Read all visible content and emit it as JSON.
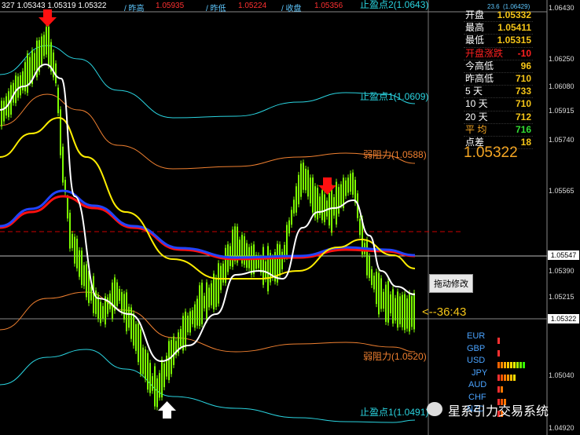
{
  "topbar": {
    "left": "327 1.05343 1.05319 1.05322",
    "open_label": "/ 昨高",
    "open_value": "1.05935",
    "low_label": "/ 昨低",
    "low_value": "1.05224",
    "close_label": "/ 收盘",
    "close_value": "1.05356",
    "spread_value": "23.6",
    "spread_peak": "(1.06429)"
  },
  "panel": {
    "rows": [
      {
        "k": "开盘",
        "v": "1.05332",
        "kc": "#ffffff",
        "vc": "#f5c518"
      },
      {
        "k": "最高",
        "v": "1.05411",
        "kc": "#ffffff",
        "vc": "#f5c518"
      },
      {
        "k": "最低",
        "v": "1.05315",
        "kc": "#ffffff",
        "vc": "#f5c518"
      },
      {
        "k": "开盘涨跌",
        "v": "-10",
        "kc": "#ff2020",
        "vc": "#ff2020"
      },
      {
        "k": "今高低",
        "v": "96",
        "kc": "#ffffff",
        "vc": "#f5c518"
      },
      {
        "k": "昨高低",
        "v": "710",
        "kc": "#ffffff",
        "vc": "#f5c518"
      },
      {
        "k": "5   天",
        "v": "733",
        "kc": "#ffffff",
        "vc": "#f5c518"
      },
      {
        "k": "10  天",
        "v": "710",
        "kc": "#ffffff",
        "vc": "#f5c518"
      },
      {
        "k": "20  天",
        "v": "712",
        "kc": "#ffffff",
        "vc": "#f5c518"
      },
      {
        "k": "平   均",
        "v": "716",
        "kc": "#f5a623",
        "vc": "#33dd33"
      },
      {
        "k": "点差",
        "v": "18",
        "kc": "#ffffff",
        "vc": "#f5c518"
      }
    ],
    "big_price": "1.05322"
  },
  "labels": {
    "tp_top": "止盈点2(1.0643)",
    "tp1": "止盈点1(1.0609)",
    "res_weak": "弱阻力(1.0588)",
    "sup_weak": "弱阻力(1.0520)",
    "tp_bottom": "止盈点1(1.0491)",
    "tooltip": "拖动修改",
    "countdown": "<--36:43"
  },
  "current_price_box": "1.05547",
  "last_price_box": "1.05322",
  "currencies": [
    {
      "name": "EUR",
      "bars": [
        "#ff3030"
      ]
    },
    {
      "name": "GBP",
      "bars": [
        "#ff3030"
      ]
    },
    {
      "name": "USD",
      "bars": [
        "#ff6600",
        "#ff8800",
        "#ffaa00",
        "#ffcc00",
        "#ffdd00",
        "#eeff00",
        "#aaff00",
        "#66ff00",
        "#33ff00"
      ]
    },
    {
      "name": "JPY",
      "bars": [
        "#ff3030",
        "#ff5500",
        "#ff7700",
        "#ff9900",
        "#ffbb00",
        "#ffdd00"
      ]
    },
    {
      "name": "AUD",
      "bars": [
        "#ff3030",
        "#ff7700"
      ]
    },
    {
      "name": "CHF",
      "bars": [
        "#ff3030",
        "#ff5500",
        "#ff7700"
      ]
    },
    {
      "name": "NZD",
      "bars": [
        "#ff3030",
        "#ff6600"
      ]
    }
  ],
  "watermark": "星系引力交易系统",
  "colors": {
    "candle": "#7CFC00",
    "white_ma": "#ffffff",
    "yellow_ma": "#ffee00",
    "blue_ma": "#2244ff",
    "red_ma": "#ff1010",
    "cyan_band": "#2ad4e0",
    "orange_band": "#f08030",
    "dashed_red": "#cc0000"
  },
  "chart_data": {
    "type": "line",
    "ylim": [
      1.0492,
      1.0646
    ],
    "y_ticks": [
      "1.06430",
      "1.06250",
      "1.06080",
      "1.05915",
      "1.05740",
      "1.05565",
      "1.05390",
      "1.05215",
      "1.05040",
      "1.04920"
    ],
    "title": ""
  }
}
